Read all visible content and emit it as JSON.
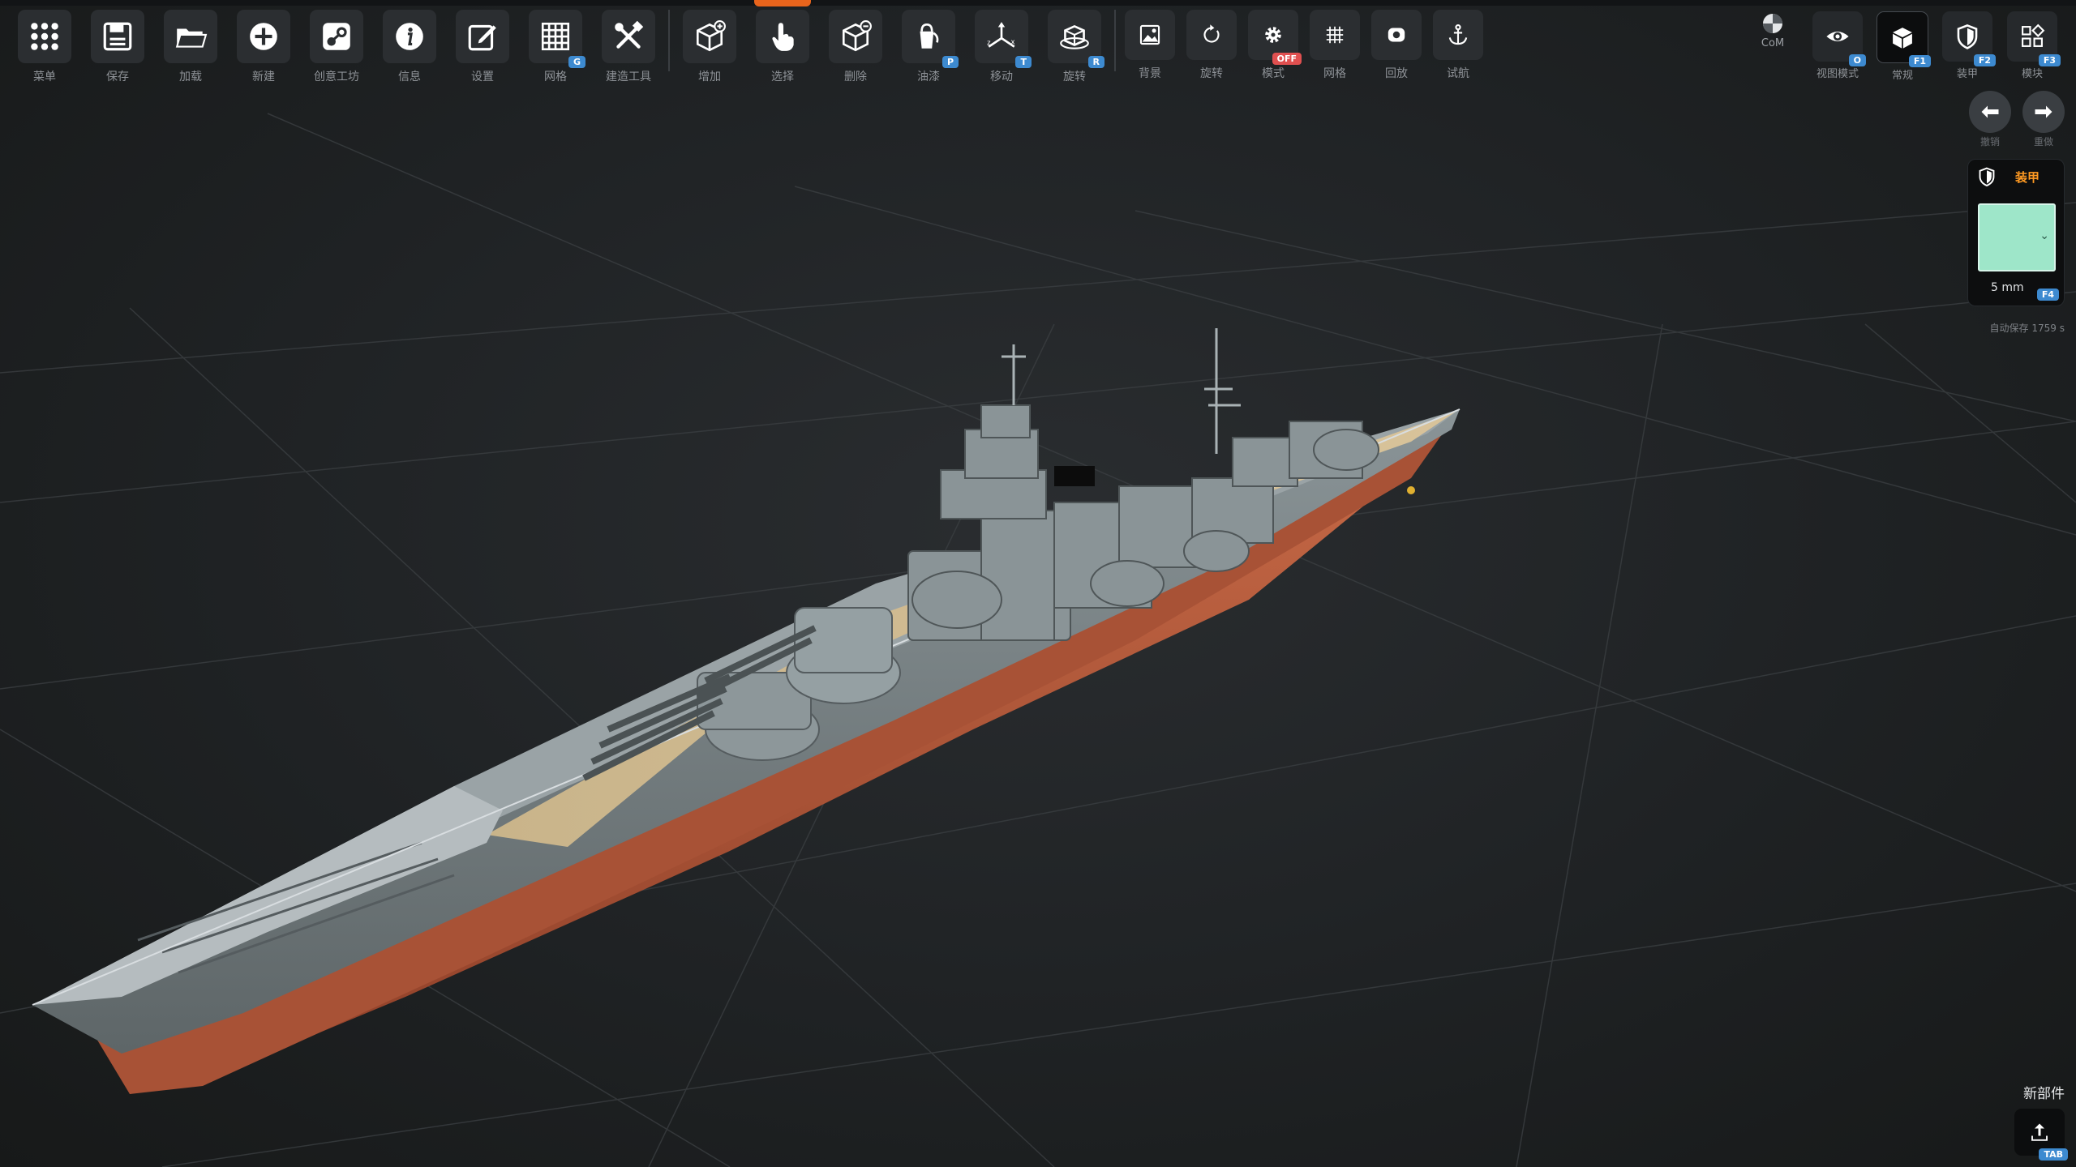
{
  "toolbar_main": [
    {
      "label": "菜单",
      "icon": "grid-dots-icon",
      "badge": ""
    },
    {
      "label": "保存",
      "icon": "floppy-icon",
      "badge": ""
    },
    {
      "label": "加载",
      "icon": "folder-icon",
      "badge": ""
    },
    {
      "label": "新建",
      "icon": "plus-circle-icon",
      "badge": ""
    },
    {
      "label": "创意工坊",
      "icon": "steam-icon",
      "badge": ""
    },
    {
      "label": "信息",
      "icon": "info-icon",
      "badge": ""
    },
    {
      "label": "设置",
      "icon": "edit-icon",
      "badge": ""
    },
    {
      "label": "网格",
      "icon": "grid-icon",
      "badge": "G"
    },
    {
      "label": "建造工具",
      "icon": "tools-icon",
      "badge": ""
    }
  ],
  "toolbar_edit": [
    {
      "label": "增加",
      "icon": "cube-add-icon",
      "badge": ""
    },
    {
      "label": "选择",
      "icon": "hand-pointer-icon",
      "badge": ""
    },
    {
      "label": "删除",
      "icon": "cube-remove-icon",
      "badge": ""
    },
    {
      "label": "油漆",
      "icon": "paint-bucket-icon",
      "badge": "P"
    },
    {
      "label": "移动",
      "icon": "axes-move-icon",
      "badge": "T"
    },
    {
      "label": "旋转",
      "icon": "cube-rotate-icon",
      "badge": "R"
    }
  ],
  "toolbar_view": [
    {
      "label": "背景",
      "icon": "image-icon",
      "badge": ""
    },
    {
      "label": "旋转",
      "icon": "rotate-icon",
      "badge": ""
    },
    {
      "label": "模式",
      "icon": "gear-icon",
      "badge": "OFF"
    },
    {
      "label": "网格",
      "icon": "small-grid-icon",
      "badge": ""
    },
    {
      "label": "回放",
      "icon": "record-icon",
      "badge": ""
    },
    {
      "label": "试航",
      "icon": "anchor-icon",
      "badge": ""
    }
  ],
  "right_toolbar": {
    "com_label": "CoM",
    "items": [
      {
        "label": "视图模式",
        "icon": "eye-icon",
        "badge": "O"
      },
      {
        "label": "常规",
        "icon": "cube-solid-icon",
        "badge": "F1",
        "active": true
      },
      {
        "label": "装甲",
        "icon": "shield-icon",
        "badge": "F2",
        "active": false
      },
      {
        "label": "模块",
        "icon": "modules-icon",
        "badge": "F3",
        "active": false
      }
    ]
  },
  "undo": {
    "undo_label": "撤销",
    "redo_label": "重做"
  },
  "armor_panel": {
    "title": "装甲",
    "thickness": "5 mm",
    "badge": "F4",
    "color": "#9ee6c9"
  },
  "autosave": {
    "label": "自动保存",
    "time": "1759 s"
  },
  "new_part": {
    "label": "新部件",
    "badge": "TAB"
  },
  "colors": {
    "accent": "#e8641c",
    "badge_blue": "#3d8ad0",
    "armor_orange": "#ff9a22",
    "deck": "#cdb88c",
    "hull_gray": "#7f8a8c",
    "hull_red": "#b35a3a"
  }
}
